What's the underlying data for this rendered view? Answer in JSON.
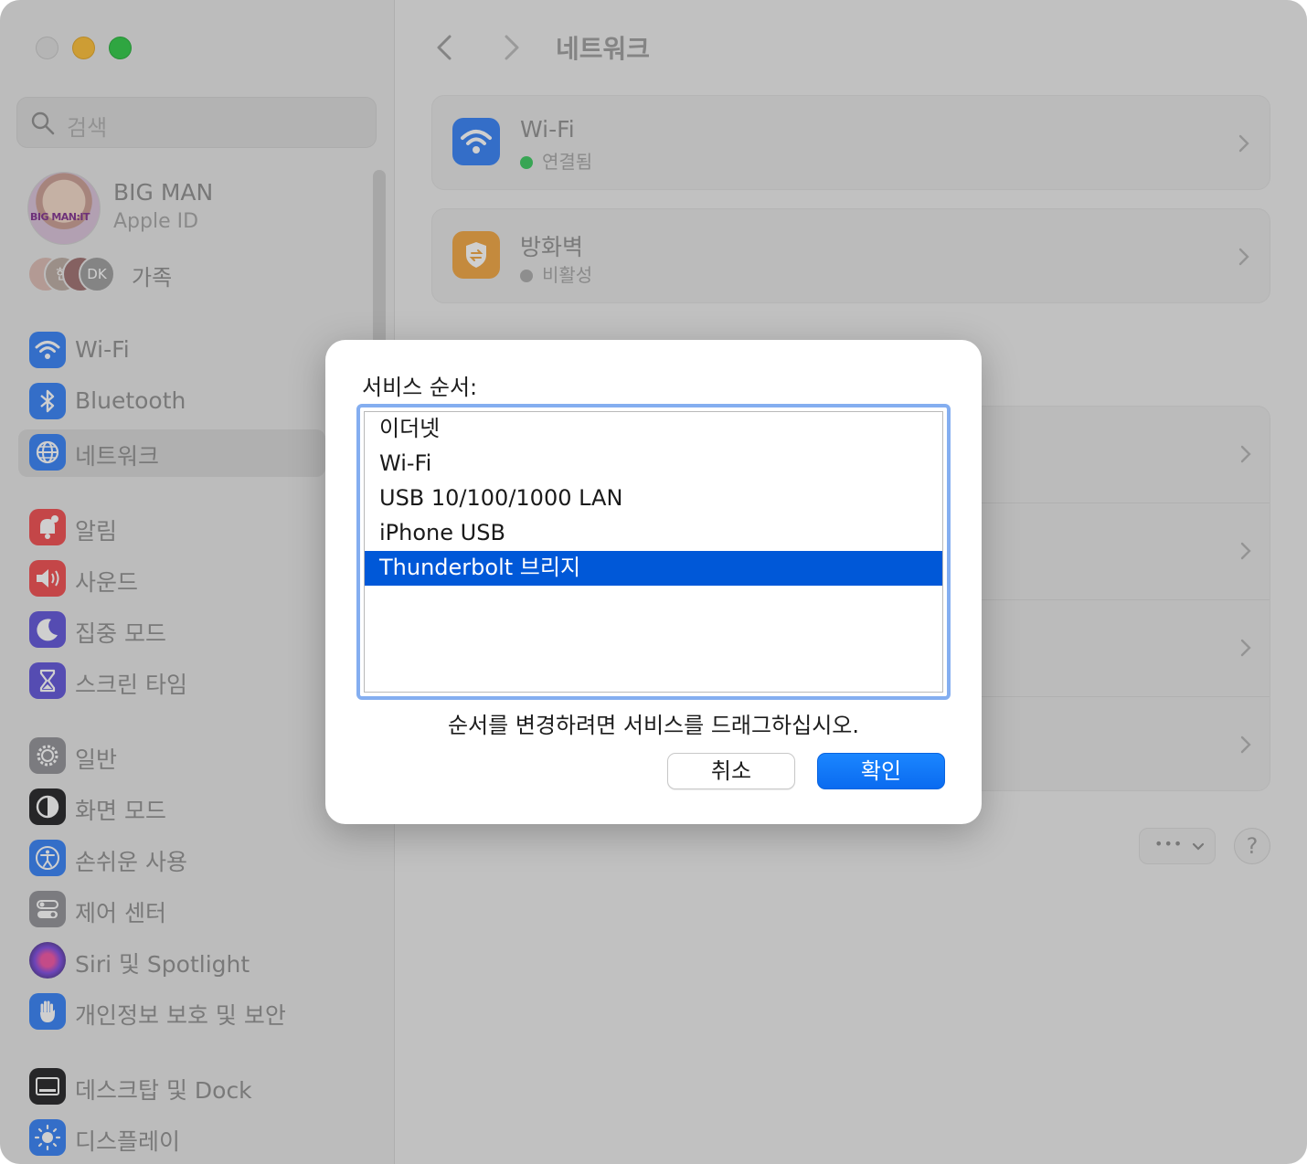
{
  "sidebar": {
    "search_placeholder": "검색",
    "profile": {
      "name": "BIG MAN",
      "subtitle": "Apple ID",
      "avatar_tag": "BIG MAN:IT"
    },
    "family": {
      "label": "가족",
      "avatars": [
        "현",
        "DK"
      ]
    },
    "items": [
      {
        "label": "Wi-Fi",
        "icon": "wifi-icon",
        "color": "#2f7cf6"
      },
      {
        "label": "Bluetooth",
        "icon": "bluetooth-icon",
        "color": "#2f7cf6"
      },
      {
        "label": "네트워크",
        "icon": "globe-icon",
        "color": "#2f7cf6",
        "selected": true
      },
      {
        "label": "알림",
        "icon": "bell-icon",
        "color": "#f0474a"
      },
      {
        "label": "사운드",
        "icon": "speaker-icon",
        "color": "#f0474a"
      },
      {
        "label": "집중 모드",
        "icon": "moon-icon",
        "color": "#5b4fd8"
      },
      {
        "label": "스크린 타임",
        "icon": "hourglass-icon",
        "color": "#5b4fd8"
      },
      {
        "label": "일반",
        "icon": "gear-icon",
        "color": "#8e8e93"
      },
      {
        "label": "화면 모드",
        "icon": "appearance-icon",
        "color": "#1c1c1e"
      },
      {
        "label": "손쉬운 사용",
        "icon": "accessibility-icon",
        "color": "#2f7cf6"
      },
      {
        "label": "제어 센터",
        "icon": "toggles-icon",
        "color": "#8e8e93"
      },
      {
        "label": "Siri 및 Spotlight",
        "icon": "siri-icon",
        "color": "#6b3fd0"
      },
      {
        "label": "개인정보 보호 및 보안",
        "icon": "hand-icon",
        "color": "#2f7cf6"
      },
      {
        "label": "데스크탑 및 Dock",
        "icon": "dock-icon",
        "color": "#1c1c1e"
      },
      {
        "label": "디스플레이",
        "icon": "sun-icon",
        "color": "#2f7cf6"
      }
    ]
  },
  "main": {
    "title": "네트워크",
    "services": [
      {
        "name": "Wi-Fi",
        "status": "연결됨",
        "status_color": "#34c759",
        "icon": "wifi-icon",
        "color": "#2f7cf6"
      },
      {
        "name": "방화벽",
        "status": "비활성",
        "status_color": "#a8a8a8",
        "icon": "firewall-icon",
        "color": "#f0a23a"
      }
    ],
    "more_button": "•••",
    "help_button": "?"
  },
  "dialog": {
    "label": "서비스 순서:",
    "items": [
      "이더넷",
      "Wi-Fi",
      "USB 10/100/1000 LAN",
      "iPhone USB",
      "Thunderbolt 브리지"
    ],
    "selected_index": 4,
    "hint": "순서를 변경하려면 서비스를 드래그하십시오.",
    "cancel": "취소",
    "ok": "확인"
  }
}
